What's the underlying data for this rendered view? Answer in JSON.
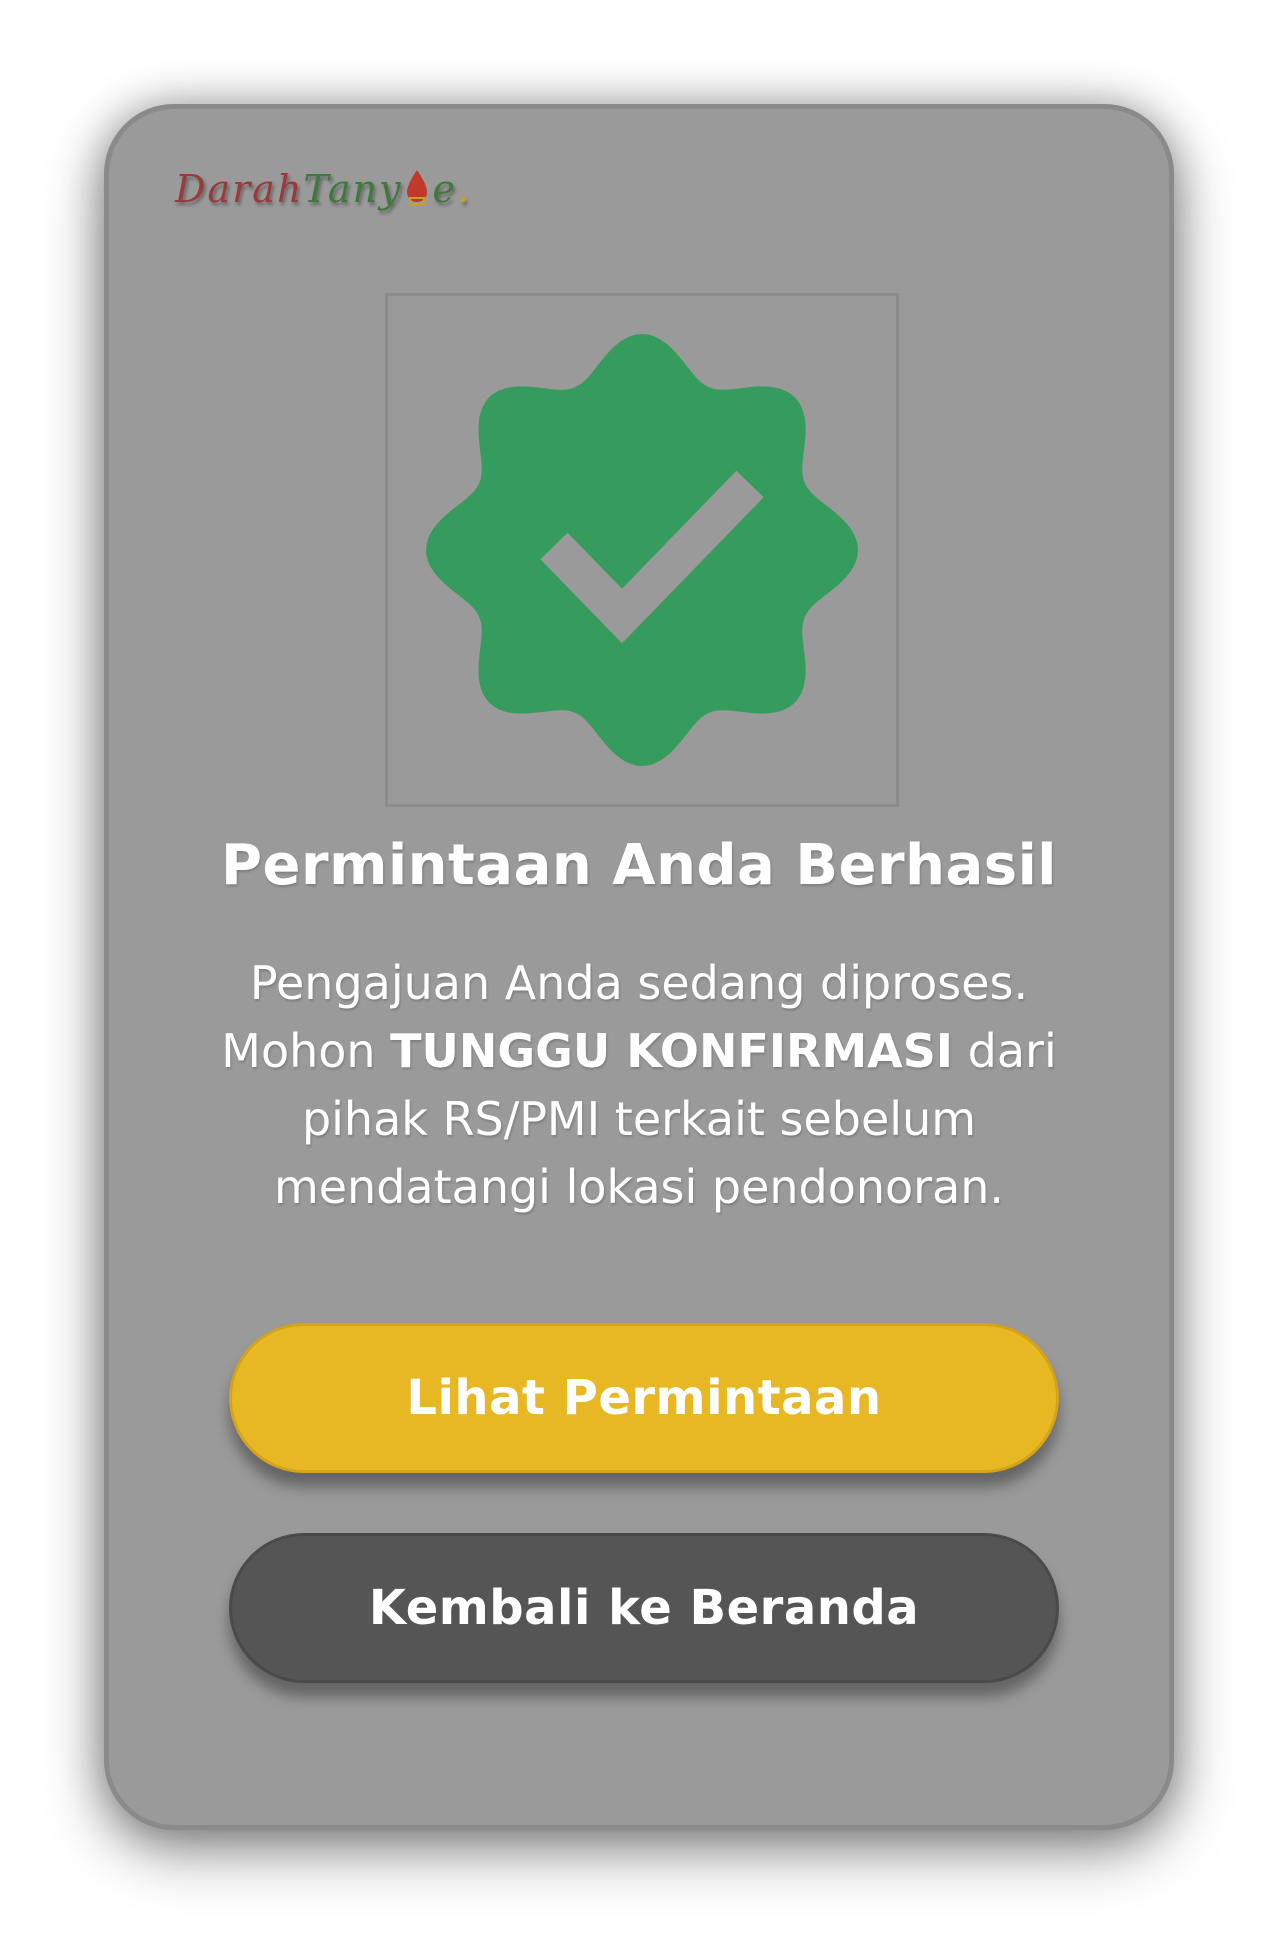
{
  "brand": {
    "logo_part1": "Darah",
    "logo_part2": "Tany",
    "logo_part3": "e",
    "logo_dot": ".",
    "drop_icon": "blood-drop-icon",
    "colors": {
      "darah": "#9b3a3a",
      "tanya": "#3f7a3c",
      "dot": "#c7a21f"
    }
  },
  "success": {
    "icon": "verified-badge-check-icon",
    "badge_color": "#369c5e",
    "title": "Permintaan Anda Berhasil",
    "message_part1": "Pengajuan Anda sedang diproses. Mohon ",
    "message_emphasis": "TUNGGU KONFIRMASI",
    "message_part2": " dari pihak RS/PMI terkait sebelum mendatangi lokasi pendonoran."
  },
  "actions": {
    "view_request_label": "Lihat Permintaan",
    "view_request_color": "#e8b824",
    "back_home_label": "Kembali ke Beranda",
    "back_home_color": "#555555"
  },
  "overlay_color": "#9a9a9a"
}
